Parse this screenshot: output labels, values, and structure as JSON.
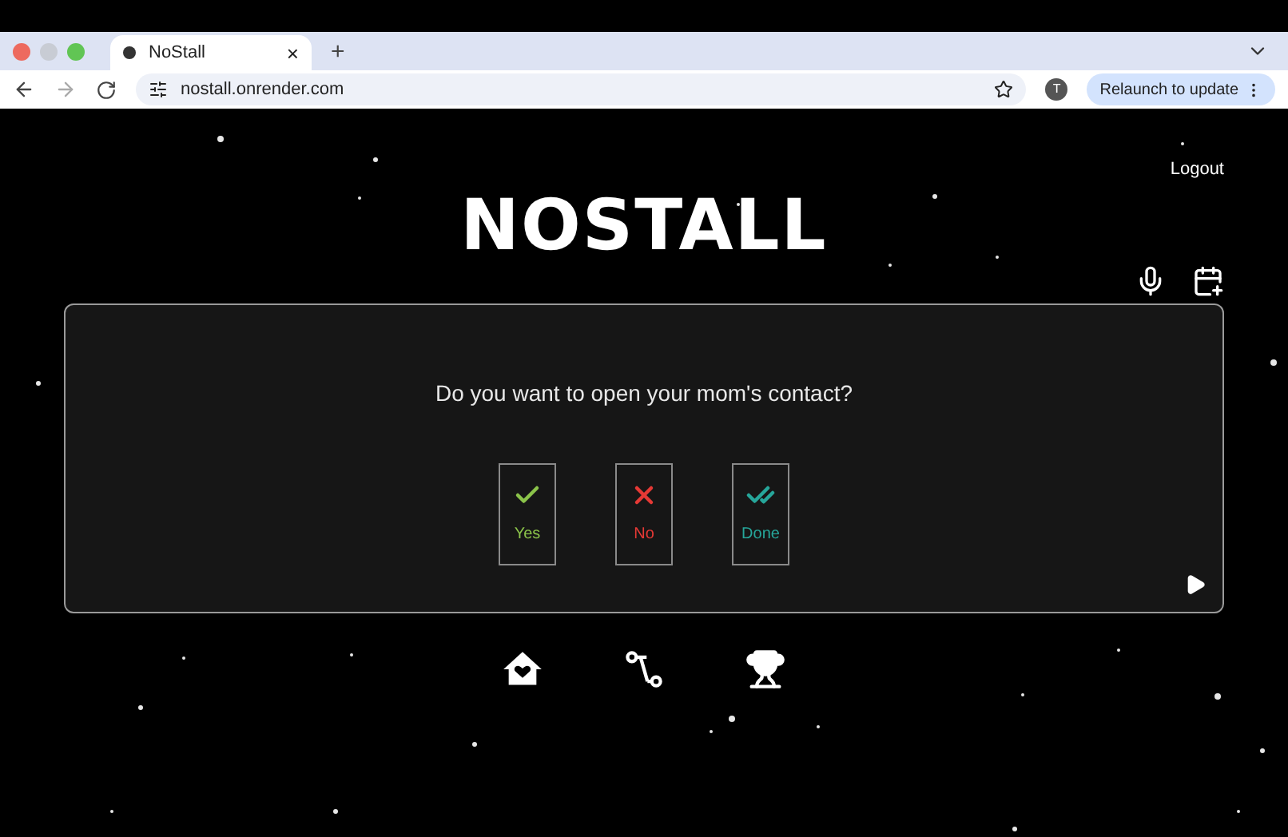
{
  "browser": {
    "tab_title": "NoStall",
    "tab_close": "×",
    "new_tab": "+",
    "url": "nostall.onrender.com",
    "profile": "T",
    "relaunch": "Relaunch to update"
  },
  "header": {
    "logout": "Logout",
    "logo": "NOSTALL"
  },
  "card": {
    "question": "Do you want to open your mom's contact?",
    "options": [
      {
        "kind": "check",
        "label": "Yes",
        "color": "#8bc34a"
      },
      {
        "kind": "cross",
        "label": "No",
        "color": "#e53935"
      },
      {
        "kind": "double-check",
        "label": "Done",
        "color": "#26a69a"
      }
    ]
  }
}
